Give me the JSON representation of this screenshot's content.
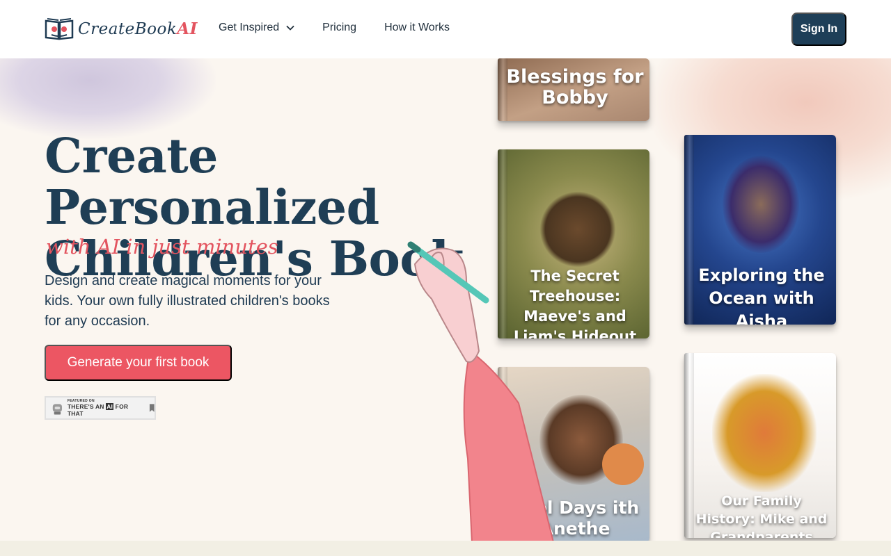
{
  "brand": {
    "name": "CreateBook",
    "suffix": "AI"
  },
  "nav": {
    "items": [
      {
        "label": "Get Inspired",
        "has_dropdown": true
      },
      {
        "label": "Pricing"
      },
      {
        "label": "How it Works"
      }
    ],
    "signin_label": "Sign In"
  },
  "hero": {
    "title_line1": "Create Personalized",
    "title_line2": "Children's Book",
    "subtitle": "with AI in just minutes",
    "description": "Design and create magical moments for your kids. Your own  fully illustrated children's books for any occasion.",
    "cta_label": "Generate your first book"
  },
  "badge": {
    "small": "FEATURED ON",
    "main_prefix": "THERE'S AN ",
    "main_highlight": "AI",
    "main_suffix": " FOR THAT"
  },
  "books": [
    {
      "title": "Blessings for Bobby"
    },
    {
      "title": "The Secret Treehouse: Maeve's and Liam's Hideout"
    },
    {
      "title": "Exploring the Ocean with Aisha"
    },
    {
      "title": "hool Days ith Anethe"
    },
    {
      "title": "Our Family History: Mike and Grandparents"
    }
  ],
  "colors": {
    "primary": "#1e3f58",
    "accent": "#ec5663",
    "background": "#fbf6f0"
  },
  "icons": [
    "book-heart-logo-icon",
    "chevron-down-icon",
    "robot-icon",
    "bookmark-icon"
  ]
}
